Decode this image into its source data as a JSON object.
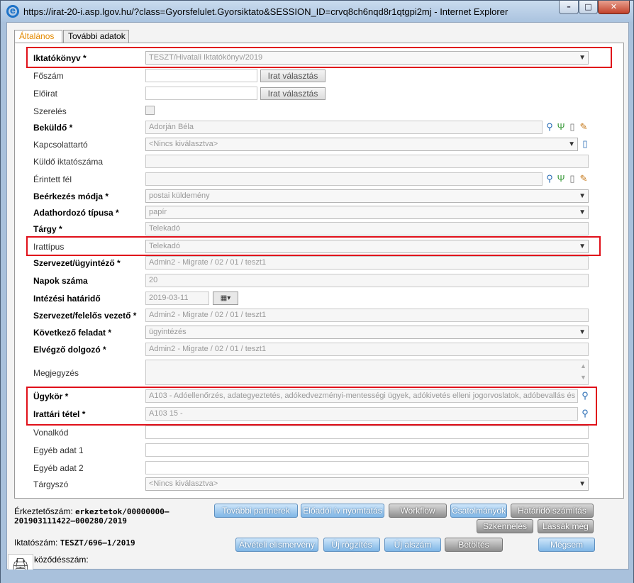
{
  "window": {
    "title": "https://irat-20-i.asp.lgov.hu/?class=Gyorsfelulet.Gyorsiktato&SESSION_ID=crvq8ch6nqd8r1qtgpi2mj - Internet Explorer",
    "icon": "ie-icon",
    "controls": {
      "minimize": "–",
      "maximize": "□",
      "close": "✕"
    }
  },
  "tabs": [
    "Általános",
    "További adatok"
  ],
  "form": {
    "iktatokonyv": {
      "label": "Iktatókönyv *",
      "value": "TESZT/Hivatali Iktatókönyv/2019"
    },
    "foszam": {
      "label": "Főszám",
      "value": "",
      "button": "Irat választás"
    },
    "eloirat": {
      "label": "Előirat",
      "value": "",
      "button": "Irat választás"
    },
    "szereles": {
      "label": "Szerelés"
    },
    "bekuldo": {
      "label": "Beküldő *",
      "value": "Adorján Béla"
    },
    "kapcsolattarto": {
      "label": "Kapcsolattartó",
      "value": "<Nincs kiválasztva>"
    },
    "kuldo_iktatoszama": {
      "label": "Küldő iktatószáma",
      "value": ""
    },
    "erintett_fel": {
      "label": "Érintett fél",
      "value": ""
    },
    "beerkezes_modja": {
      "label": "Beérkezés módja *",
      "value": "postai küldemény"
    },
    "adathordozo_tipusa": {
      "label": "Adathordozó típusa *",
      "value": "papír"
    },
    "targy": {
      "label": "Tárgy *",
      "value": "Telekadó"
    },
    "irattipus": {
      "label": "Irattípus",
      "value": "Telekadó"
    },
    "szervezet_ugyintezo": {
      "label": "Szervezet/ügyintéző *",
      "value": "Admin2 - Migrate / 02 / 01 / teszt1"
    },
    "napok_szama": {
      "label": "Napok száma",
      "value": "20"
    },
    "intezesi_hatarido": {
      "label": "Intézési határidő",
      "value": "2019-03-11"
    },
    "szervezet_felelos_vezeto": {
      "label": "Szervezet/felelős vezető *",
      "value": "Admin2 - Migrate / 02 / 01 / teszt1"
    },
    "kovetkezo_feladat": {
      "label": "Következő feladat *",
      "value": "ügyintézés"
    },
    "elvegzo_dolgozo": {
      "label": "Elvégző dolgozó *",
      "value": "Admin2 - Migrate / 02 / 01 / teszt1"
    },
    "megjegyzes": {
      "label": "Megjegyzés",
      "value": ""
    },
    "ugykor": {
      "label": "Ügykör *",
      "value": "A103 - Adóellenőrzés, adategyeztetés, adókedvezményi-mentességi ügyek, adókivetés elleni jogorvoslatok, adóbevallás és"
    },
    "irattari_tetel": {
      "label": "Irattári tétel *",
      "value": "A103 15 -"
    },
    "vonalkod": {
      "label": "Vonalkód",
      "value": ""
    },
    "egyeb_adat_1": {
      "label": "Egyéb adat 1",
      "value": ""
    },
    "egyeb_adat_2": {
      "label": "Egyéb adat 2",
      "value": ""
    },
    "targyszo": {
      "label": "Tárgyszó",
      "value": "<Nincs kiválasztva>"
    }
  },
  "footer": {
    "erkeztetoszam_label": "Érkeztetőszám:",
    "erkeztetoszam_value1": "erkeztetok/00000000–",
    "erkeztetoszam_value2": "201903111422–000280/2019",
    "iktatoszam_label": "Iktatószám:",
    "iktatoszam_value": "TESZT/696–1/2019",
    "kozodesszam_label": "köződésszám:",
    "buttons": {
      "tovabbi_partnerek": "További partnerek",
      "eloadoi_iv": "Előadói ív nyomtatás",
      "workflow": "Workflow",
      "csatolmanyok": "Csatolmányok",
      "hatarido_szamitas": "Határidő számítás",
      "szkenneles": "Szkennelés",
      "lassak_meg": "Lássák még",
      "atveteli": "Átvételi elismervény",
      "uj_rogzites": "Új rögzítés",
      "uj_alszam": "Új alszám",
      "betoltes": "Betöltés",
      "megsem": "Mégsem"
    }
  },
  "colors": {
    "highlight_border": "#e0101a",
    "active_tab": "#e38a00",
    "blue_button": "#7fb6e6",
    "gray_button": "#8f8f8f"
  }
}
